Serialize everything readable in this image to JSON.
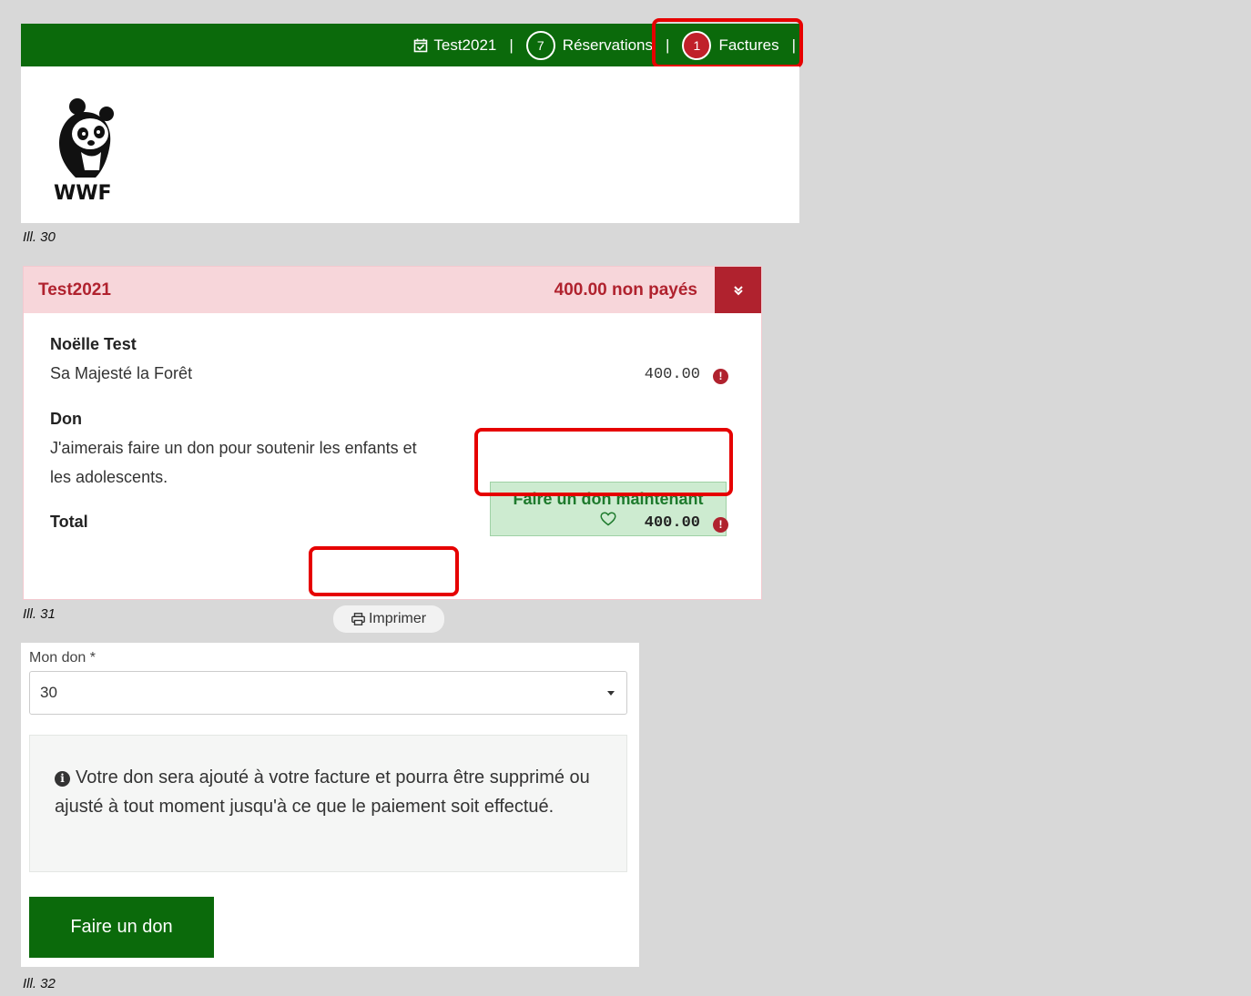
{
  "topbar": {
    "event_label": "Test2021",
    "separator": "|",
    "reservations": {
      "count": "7",
      "label": "Réservations"
    },
    "invoices": {
      "count": "1",
      "label": "Factures"
    }
  },
  "logo": {
    "text": "WWF"
  },
  "captions": {
    "ill30": "Ill. 30",
    "ill31": "Ill. 31",
    "ill32": "Ill. 32"
  },
  "invoice_card": {
    "title": "Test2021",
    "amount_status": "400.00 non payés",
    "toggle_icon": "double-chevron-down-icon",
    "person_name": "Noëlle Test",
    "item_label": "Sa Majesté la Forêt",
    "item_amount": "400.00",
    "don_title": "Don",
    "don_text_line1": "J'aimerais faire un don pour soutenir les enfants et",
    "don_text_line2": "les adolescents.",
    "donate_now_label": "Faire un don maintenant",
    "total_label": "Total",
    "total_amount": "400.00",
    "print_label": "Imprimer"
  },
  "donation_form": {
    "label": "Mon don *",
    "selected_value": "30",
    "info_text": "Votre don sera ajouté à votre facture et pourra être supprimé ou ajusté à tout moment jusqu'à ce que le paiement soit effectué.",
    "submit_label": "Faire un don"
  },
  "colors": {
    "brand_green": "#0b6a0b",
    "danger_red": "#b0222e",
    "highlight_red": "#e60000",
    "donate_bg": "#cdebd0"
  }
}
